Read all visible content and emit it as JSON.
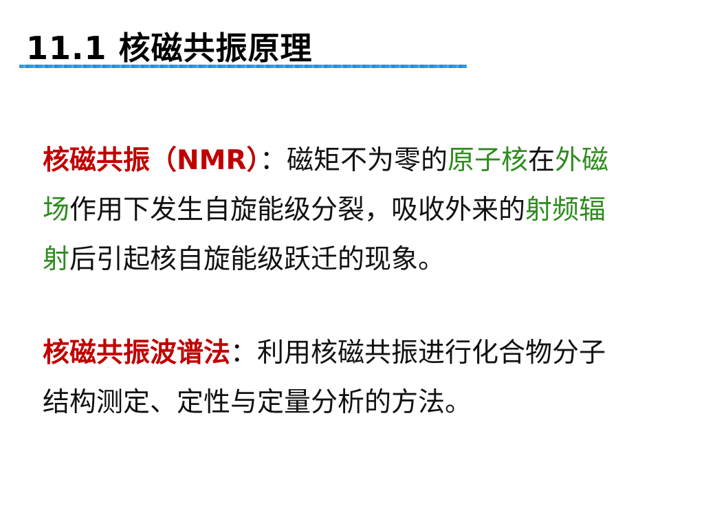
{
  "slide": {
    "title": "11.1 核磁共振原理",
    "accent_color": "#2b9be8",
    "paragraphs": [
      {
        "lines": [
          [
            {
              "t": "核磁共振（NMR）",
              "c": "red"
            },
            {
              "t": "：磁矩不为零的",
              "c": "black"
            },
            {
              "t": "原子核",
              "c": "green"
            },
            {
              "t": "在",
              "c": "black"
            },
            {
              "t": "外磁",
              "c": "green"
            }
          ],
          [
            {
              "t": "场",
              "c": "green"
            },
            {
              "t": "作用下发生自旋能级分裂，吸收外来的",
              "c": "black"
            },
            {
              "t": "射频辐",
              "c": "green"
            }
          ],
          [
            {
              "t": "射",
              "c": "green"
            },
            {
              "t": "后引起核自旋能级跃迁的现象。",
              "c": "black"
            }
          ]
        ]
      },
      {
        "lines": [
          [
            {
              "t": "核磁共振波谱法",
              "c": "red"
            },
            {
              "t": "：利用核磁共振进行化合物分子",
              "c": "black"
            }
          ],
          [
            {
              "t": "结构测定、定性与定量分析的方法。",
              "c": "black"
            }
          ]
        ]
      }
    ]
  }
}
